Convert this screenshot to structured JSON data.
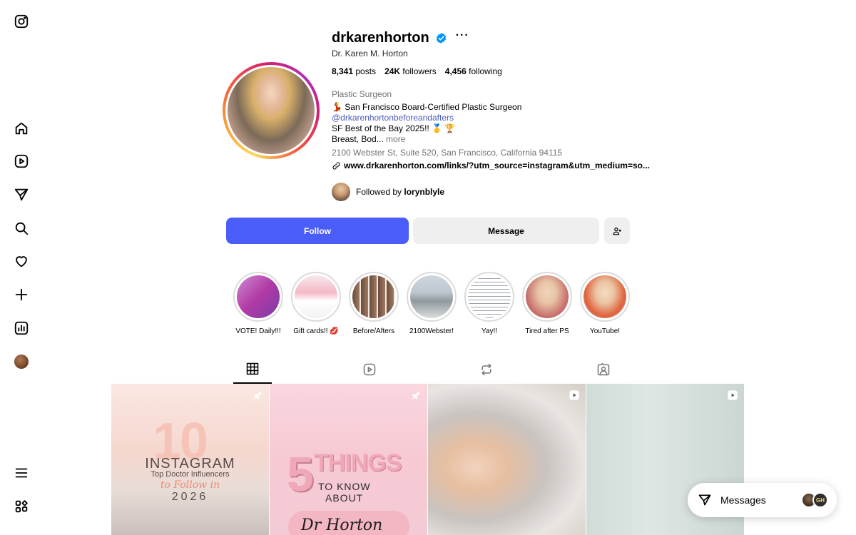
{
  "profile": {
    "username": "drkarenhorton",
    "full_name": "Dr. Karen M. Horton",
    "more": "···",
    "stats": {
      "posts_value": "8,341",
      "posts_label": "posts",
      "followers_value": "24K",
      "followers_label": "followers",
      "following_value": "4,456",
      "following_label": "following"
    },
    "category": "Plastic Surgeon",
    "bio": {
      "line1": "💃 San Francisco Board-Certified Plastic Surgeon",
      "mention": "@drkarenhortonbeforeandafters",
      "line3": "SF Best of the Bay 2025!! 🥇 🏆",
      "line4": "Breast, Bod...",
      "more": "more",
      "address": "2100 Webster St, Suite 520, San Francisco, California 94115"
    },
    "link": "www.drkarenhorton.com/links/?utm_source=instagram&utm_medium=so...",
    "followed_by_prefix": "Followed by",
    "followed_by_user": "lorynblyle"
  },
  "actions": {
    "follow": "Follow",
    "message": "Message"
  },
  "highlights": [
    {
      "label": "VOTE! Daily!!!"
    },
    {
      "label": "Gift cards!! 💋"
    },
    {
      "label": "Before/Afters"
    },
    {
      "label": "2100Webster!"
    },
    {
      "label": "Yay!!"
    },
    {
      "label": "Tired after PS"
    },
    {
      "label": "YouTube!"
    }
  ],
  "posts": {
    "p1": {
      "number": "10",
      "title": "INSTAGRAM",
      "subtitle": "Top Doctor Influencers",
      "script": "to Follow in",
      "year": "2026"
    },
    "p2": {
      "number": "5",
      "title": "THINGS",
      "line1": "TO KNOW",
      "line2": "ABOUT",
      "name": "Dr Horton"
    }
  },
  "messages": {
    "label": "Messages",
    "avatar2_initials": "GH"
  },
  "colors": {
    "follow_button": "#4a5df9",
    "verified": "#0095f6",
    "mention": "#4a5db8"
  }
}
